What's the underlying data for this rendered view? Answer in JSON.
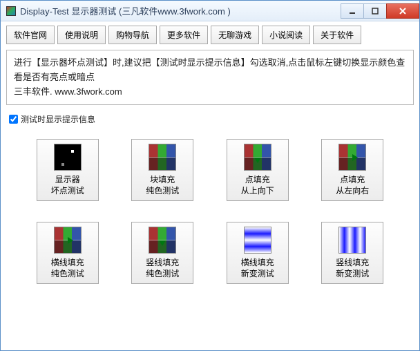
{
  "window": {
    "title": "Display-Test 显示器测试 (三凡软件www.3fwork.com )"
  },
  "toolbar": [
    "软件官网",
    "使用说明",
    "购物导航",
    "更多软件",
    "无聊游戏",
    "小说阅读",
    "关于软件"
  ],
  "notice": {
    "line1": "进行【显示器坏点测试】时,建议把【测试时显示提示信息】勾选取消,点击鼠标左键切换显示颜色查看是否有亮点或暗点",
    "line2": "三丰软件. www.3fwork.com"
  },
  "checkbox": {
    "label": "测试时显示提示信息",
    "checked": true
  },
  "tests": [
    {
      "label": "显示器\n坏点测试"
    },
    {
      "label": "块填充\n纯色测试"
    },
    {
      "label": "点填充\n从上向下"
    },
    {
      "label": "点填充\n从左向右"
    },
    {
      "label": "横线填充\n纯色测试"
    },
    {
      "label": "竖线填充\n纯色测试"
    },
    {
      "label": "横线填充\n新变测试"
    },
    {
      "label": "竖线填充\n新变测试"
    }
  ]
}
